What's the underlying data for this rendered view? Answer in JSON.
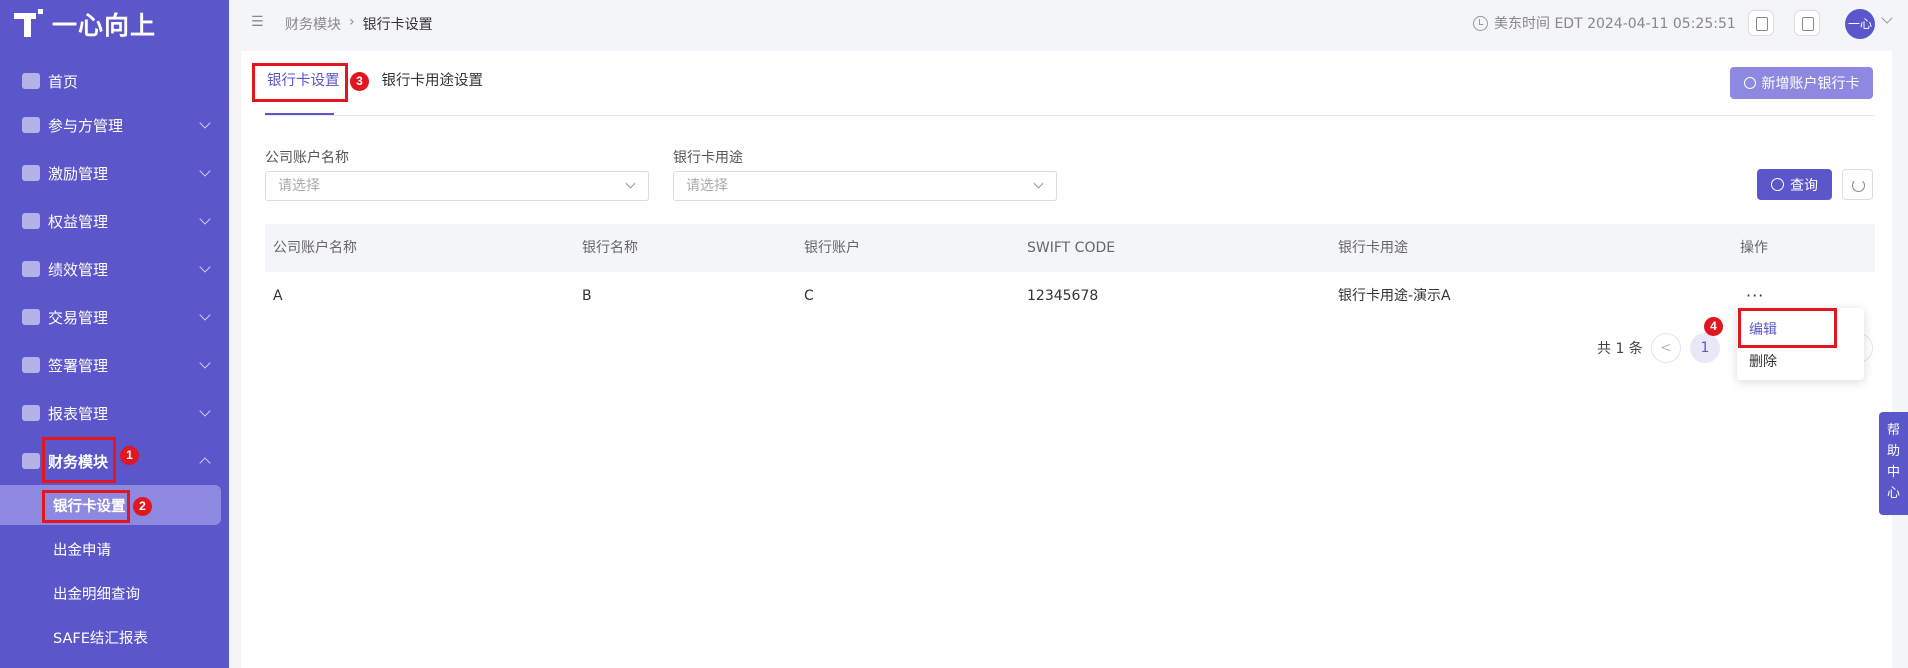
{
  "app": {
    "brand": "一心向上"
  },
  "sidebar": {
    "items": [
      {
        "label": "首页",
        "icon": "home-icon"
      },
      {
        "label": "参与方管理",
        "icon": "participant-icon"
      },
      {
        "label": "激励管理",
        "icon": "incentive-icon"
      },
      {
        "label": "权益管理",
        "icon": "equity-icon"
      },
      {
        "label": "绩效管理",
        "icon": "performance-icon"
      },
      {
        "label": "交易管理",
        "icon": "trade-icon"
      },
      {
        "label": "签署管理",
        "icon": "sign-icon"
      },
      {
        "label": "报表管理",
        "icon": "report-icon"
      },
      {
        "label": "财务模块",
        "icon": "finance-icon"
      }
    ],
    "sub_items": [
      {
        "label": "银行卡设置"
      },
      {
        "label": "出金申请"
      },
      {
        "label": "出金明细查询"
      },
      {
        "label": "SAFE结汇报表"
      }
    ]
  },
  "header": {
    "breadcrumb": [
      "财务模块",
      "银行卡设置"
    ],
    "clock": "美东时间 EDT 2024-04-11 05:25:51",
    "avatar": "一心"
  },
  "tabs": [
    {
      "label": "银行卡设置",
      "active": true
    },
    {
      "label": "银行卡用途设置",
      "active": false
    }
  ],
  "actions": {
    "add_label": "新增账户银行卡",
    "query_label": "查询"
  },
  "filters": {
    "account": {
      "label": "公司账户名称",
      "placeholder": "请选择"
    },
    "usage": {
      "label": "银行卡用途",
      "placeholder": "请选择"
    }
  },
  "table": {
    "columns": [
      "公司账户名称",
      "银行名称",
      "银行账户",
      "SWIFT CODE",
      "银行卡用途",
      "操作"
    ],
    "rows": [
      [
        "A",
        "B",
        "C",
        "12345678",
        "银行卡用途-演示A",
        "···"
      ]
    ]
  },
  "pagination": {
    "total": "共 1 条",
    "current": "1",
    "prev": "<"
  },
  "dropdown": {
    "items": [
      "编辑",
      "删除"
    ]
  },
  "annotations": [
    "1",
    "2",
    "3",
    "4"
  ],
  "help": {
    "chars": [
      "帮",
      "助",
      "中",
      "心"
    ]
  },
  "colors": {
    "primary": "#5b56c9",
    "light_primary": "#8d89e0",
    "annotation": "#e2161e"
  }
}
